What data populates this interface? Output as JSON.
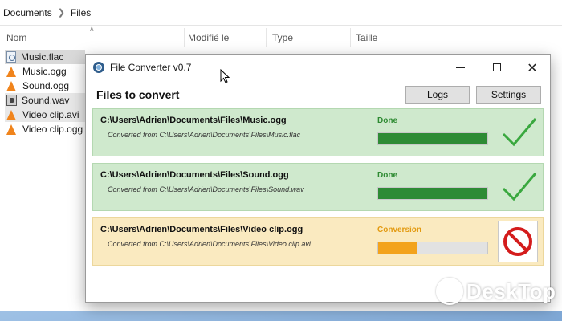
{
  "explorer": {
    "breadcrumb": [
      "Documents",
      "Files"
    ],
    "columns": [
      "Nom",
      "Modifié le",
      "Type",
      "Taille"
    ],
    "files": [
      {
        "name": "Music.flac",
        "icon": "audio-file-icon",
        "state": "selected"
      },
      {
        "name": "Music.ogg",
        "icon": "vlc-cone-icon",
        "state": ""
      },
      {
        "name": "Sound.ogg",
        "icon": "vlc-cone-icon",
        "state": ""
      },
      {
        "name": "Sound.wav",
        "icon": "wav-file-icon",
        "state": "hover"
      },
      {
        "name": "Video clip.avi",
        "icon": "vlc-cone-icon",
        "state": "hover"
      },
      {
        "name": "Video clip.ogg",
        "icon": "vlc-cone-icon",
        "state": ""
      }
    ]
  },
  "converter": {
    "window_title": "File Converter v0.7",
    "heading": "Files to convert",
    "logs_label": "Logs",
    "settings_label": "Settings",
    "jobs": [
      {
        "path": "C:\\Users\\Adrien\\Documents\\Files\\Music.ogg",
        "source": "Converted from C:\\Users\\Adrien\\Documents\\Files\\Music.flac",
        "status": "Done",
        "progress": 1.0,
        "state": "done"
      },
      {
        "path": "C:\\Users\\Adrien\\Documents\\Files\\Sound.ogg",
        "source": "Converted from C:\\Users\\Adrien\\Documents\\Files\\Sound.wav",
        "status": "Done",
        "progress": 1.0,
        "state": "done"
      },
      {
        "path": "C:\\Users\\Adrien\\Documents\\Files\\Video clip.ogg",
        "source": "Converted from C:\\Users\\Adrien\\Documents\\Files\\Video clip.avi",
        "status": "Conversion",
        "progress": 0.35,
        "state": "converting"
      }
    ]
  },
  "watermark": {
    "text": "DeskTop"
  },
  "colors": {
    "done_bg": "#cfe9cd",
    "done_bar": "#2e8b35",
    "converting_bg": "#faeac0",
    "converting_bar": "#f3a31c",
    "cancel_red": "#d41c1c",
    "check_green": "#3aa83f"
  }
}
